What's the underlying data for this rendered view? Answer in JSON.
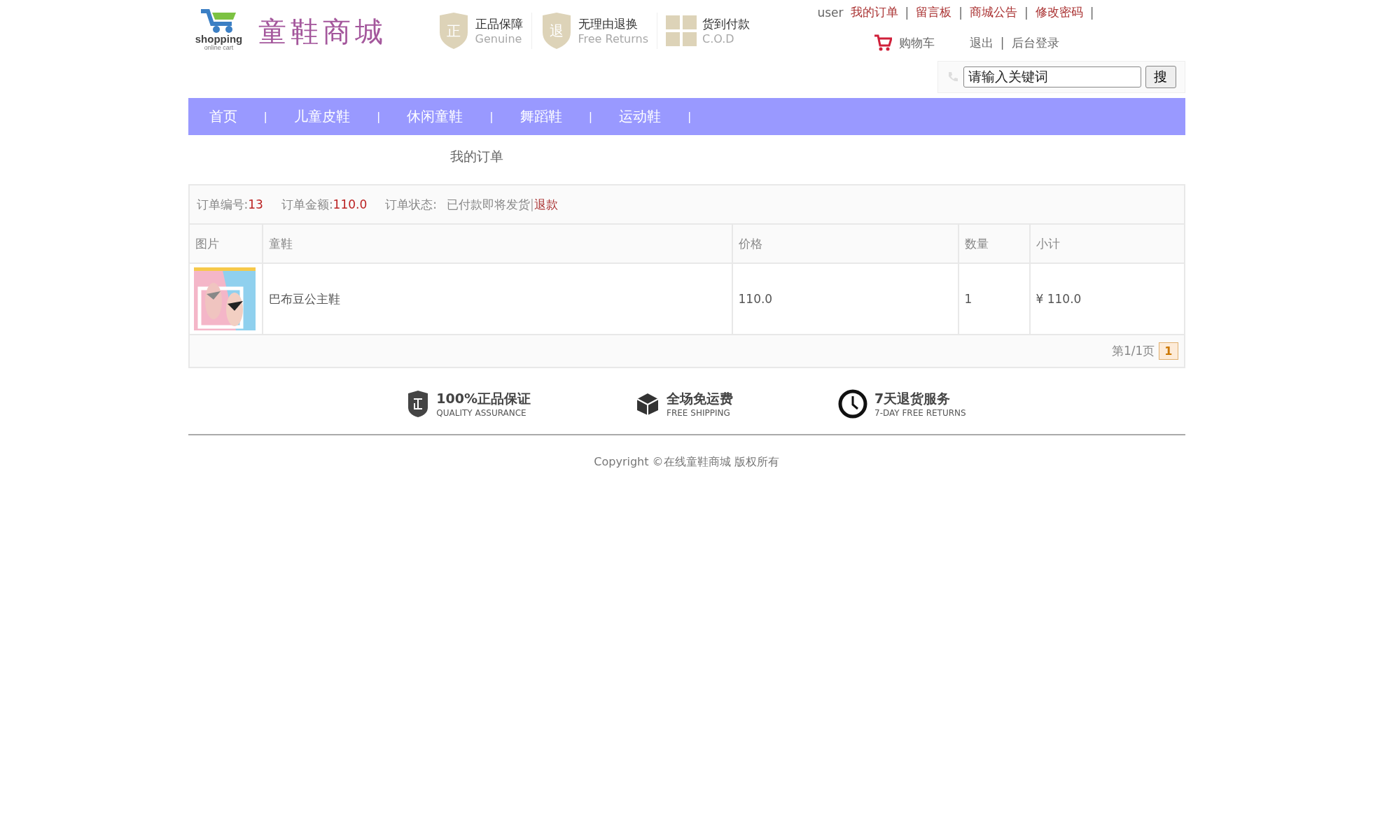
{
  "header": {
    "logo": {
      "text": "shopping",
      "subtext": "online cart"
    },
    "site_title": "童鞋商城",
    "badges": [
      {
        "icon_char": "正",
        "title": "正品保障",
        "subtitle": "Genuine",
        "kind": "shield"
      },
      {
        "icon_char": "退",
        "title": "无理由退换",
        "subtitle": "Free Returns",
        "kind": "shield"
      },
      {
        "title": "货到付款",
        "subtitle": "C.O.D",
        "kind": "gift"
      }
    ],
    "user": "user",
    "separator": "|",
    "links": [
      {
        "label": "我的订单"
      },
      {
        "label": "留言板"
      },
      {
        "label": "商城公告"
      },
      {
        "label": "修改密码"
      }
    ],
    "cart": "购物车",
    "logout": "退出",
    "admin": "后台登录",
    "search": {
      "value": "请输入关键词",
      "button": "搜"
    }
  },
  "nav": {
    "separator": "|",
    "items": [
      {
        "label": "首页"
      },
      {
        "label": "儿童皮鞋"
      },
      {
        "label": "休闲童鞋"
      },
      {
        "label": "舞蹈鞋"
      },
      {
        "label": "运动鞋"
      }
    ]
  },
  "page_title": "我的订单",
  "order": {
    "number_label": "订单编号:",
    "number": "13",
    "amount_label": "订单金额:",
    "amount": "110.0",
    "status_label": "订单状态:",
    "status": "已付款即将发货",
    "separator": "|",
    "refund": "退款",
    "columns": [
      "图片",
      "童鞋",
      "价格",
      "数量",
      "小计"
    ],
    "rows": [
      {
        "name": "巴布豆公主鞋",
        "price": "110.0",
        "quantity": "1",
        "subtotal": "¥ 110.0"
      }
    ],
    "pager": {
      "summary": "第1/1页",
      "pages": [
        {
          "label": "1",
          "selected": true
        }
      ]
    }
  },
  "footer": {
    "features": [
      {
        "kind": "shield",
        "title": "100%正品保证",
        "subtitle": "QUALITY ASSURANCE"
      },
      {
        "kind": "box",
        "title": "全场免运费",
        "subtitle": "FREE SHIPPING"
      },
      {
        "kind": "clock",
        "title": "7天退货服务",
        "subtitle": "7-DAY FREE RETURNS"
      }
    ],
    "copyright": "Copyright ©在线童鞋商城 版权所有"
  }
}
